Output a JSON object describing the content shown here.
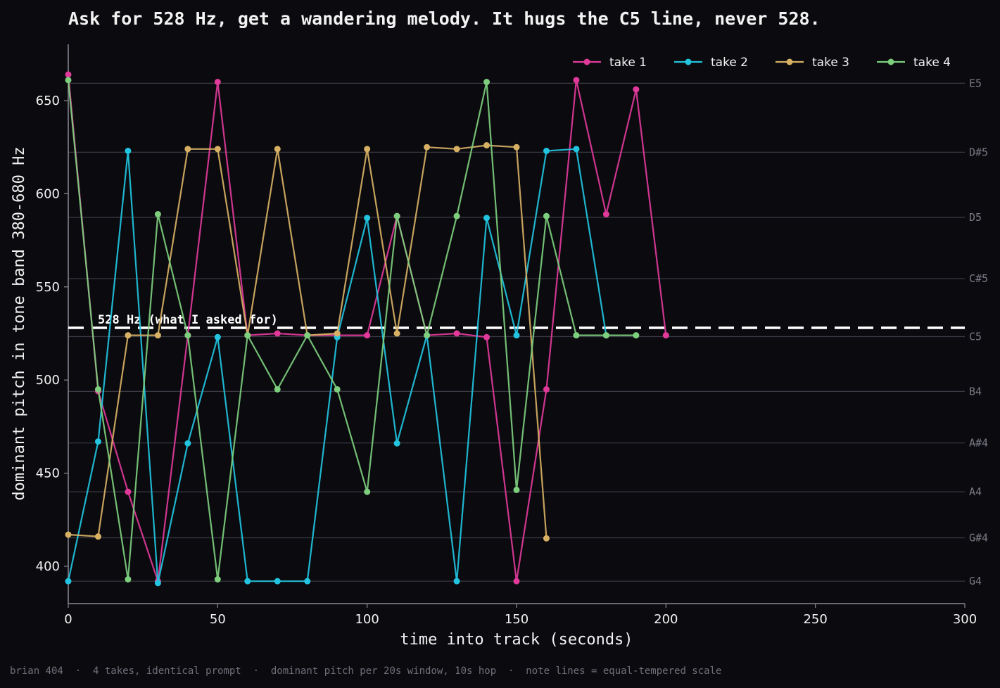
{
  "chart_data": {
    "type": "line",
    "title": "Ask for 528 Hz, get a wandering melody. It hugs the C5 line, never 528.",
    "xlabel": "time into track (seconds)",
    "ylabel": "dominant pitch in tone band 380-680 Hz",
    "xlim": [
      0,
      300
    ],
    "ylim": [
      380,
      680
    ],
    "xticks": [
      0,
      50,
      100,
      150,
      200,
      250,
      300
    ],
    "yticks": [
      400,
      450,
      500,
      550,
      600,
      650
    ],
    "grid": false,
    "legend_position": "top-right",
    "note_lines": [
      {
        "label": "G4",
        "hz": 392
      },
      {
        "label": "G#4",
        "hz": 415.3
      },
      {
        "label": "A4",
        "hz": 440
      },
      {
        "label": "A#4",
        "hz": 466.2
      },
      {
        "label": "B4",
        "hz": 493.9
      },
      {
        "label": "C5",
        "hz": 523.3
      },
      {
        "label": "C#5",
        "hz": 554.4
      },
      {
        "label": "D5",
        "hz": 587.3
      },
      {
        "label": "D#5",
        "hz": 622.3
      },
      {
        "label": "E5",
        "hz": 659.3
      }
    ],
    "reference_line": {
      "value": 528,
      "label": "528 Hz  (what I asked for)",
      "color": "#ffffff"
    },
    "series": [
      {
        "name": "take 1",
        "color": "#e0399a",
        "x": [
          0,
          10,
          20,
          30,
          40,
          50,
          60,
          70,
          80,
          90,
          100,
          110,
          120,
          130,
          140,
          150,
          160,
          170,
          180,
          190,
          200
        ],
        "y": [
          664,
          494,
          440,
          392,
          524,
          660,
          524,
          525,
          524,
          524,
          524,
          588,
          524,
          525,
          523,
          392,
          495,
          661,
          589,
          656,
          524
        ]
      },
      {
        "name": "take 2",
        "color": "#22c4df",
        "x": [
          0,
          10,
          20,
          30,
          40,
          50,
          60,
          70,
          80,
          90,
          100,
          110,
          120,
          130,
          140,
          150,
          160,
          170,
          180
        ],
        "y": [
          392,
          467,
          623,
          391,
          466,
          523,
          392,
          392,
          392,
          523,
          587,
          466,
          524,
          392,
          587,
          524,
          623,
          624,
          524
        ]
      },
      {
        "name": "take 3",
        "color": "#d7b064",
        "x": [
          0,
          10,
          20,
          30,
          40,
          50,
          60,
          70,
          80,
          90,
          100,
          110,
          120,
          130,
          140,
          150,
          160
        ],
        "y": [
          417,
          416,
          524,
          524,
          624,
          624,
          524,
          624,
          524,
          525,
          624,
          525,
          625,
          624,
          626,
          625,
          415
        ]
      },
      {
        "name": "take 4",
        "color": "#7dce7d",
        "x": [
          0,
          10,
          20,
          30,
          40,
          50,
          60,
          70,
          80,
          90,
          100,
          110,
          120,
          130,
          140,
          150,
          160,
          170,
          180,
          190
        ],
        "y": [
          661,
          495,
          393,
          589,
          524,
          393,
          524,
          495,
          524,
          495,
          440,
          588,
          524,
          588,
          660,
          441,
          588,
          524,
          524,
          524
        ]
      }
    ]
  },
  "footer": "brian 404  ·  4 takes, identical prompt  ·  dominant pitch per 20s window, 10s hop  ·  note lines = equal-tempered scale"
}
